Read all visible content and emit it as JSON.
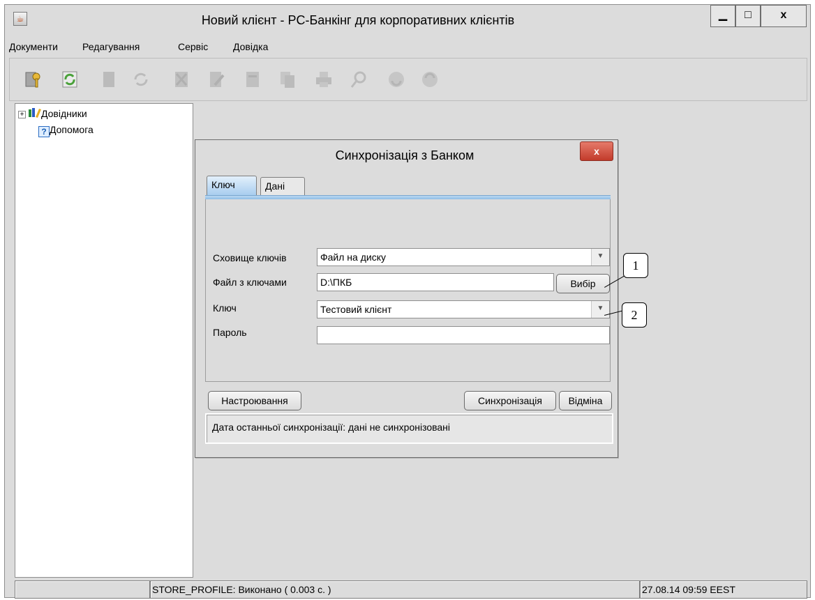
{
  "window": {
    "title": "Новий клієнт - PC-Банкінг для корпоративних клієнтів",
    "minimize": "▁",
    "maximize": "□",
    "close": "x"
  },
  "menu": [
    "Документи",
    "Редагування",
    "Сервіс",
    "Довідка"
  ],
  "toolbar": {
    "buttons": [
      {
        "name": "keys-icon",
        "enabled": true
      },
      {
        "name": "sync-icon",
        "enabled": true
      },
      {
        "name": "document-icon",
        "enabled": false
      },
      {
        "name": "refresh-icon",
        "enabled": false
      },
      {
        "name": "delete-icon",
        "enabled": false
      },
      {
        "name": "edit-icon",
        "enabled": false
      },
      {
        "name": "view-icon",
        "enabled": false
      },
      {
        "name": "copy-icon",
        "enabled": false
      },
      {
        "name": "print-icon",
        "enabled": false
      },
      {
        "name": "search-icon",
        "enabled": false
      },
      {
        "name": "send-icon",
        "enabled": false
      },
      {
        "name": "receive-icon",
        "enabled": false
      }
    ]
  },
  "tree": {
    "items": [
      {
        "label": "Довідники",
        "icon": "books-icon",
        "expander": "+"
      },
      {
        "label": "Допомога",
        "icon": "help-icon"
      }
    ]
  },
  "dialog": {
    "title": "Синхронізація з Банком",
    "close": "x",
    "tabs": [
      "Ключ",
      "Дані"
    ],
    "fields": {
      "keystore_label": "Сховище ключів",
      "keystore_value": "Файл на диску",
      "keyfile_label": "Файл з ключами",
      "keyfile_value": "D:\\ПКБ",
      "choose_button": "Вибір",
      "key_label": "Ключ",
      "key_value": "Тестовий клієнт",
      "password_label": "Пароль",
      "password_value": ""
    },
    "buttons": {
      "settings": "Настроювання",
      "sync": "Синхронізація",
      "cancel": "Відміна"
    },
    "status": "Дата останньої синхронізації:  дані не синхронізовані"
  },
  "callouts": [
    "1",
    "2"
  ],
  "statusbar": {
    "cell1": "",
    "message": "STORE_PROFILE: Виконано ( 0.003 с. )",
    "datetime": "27.08.14 09:59 EEST"
  }
}
